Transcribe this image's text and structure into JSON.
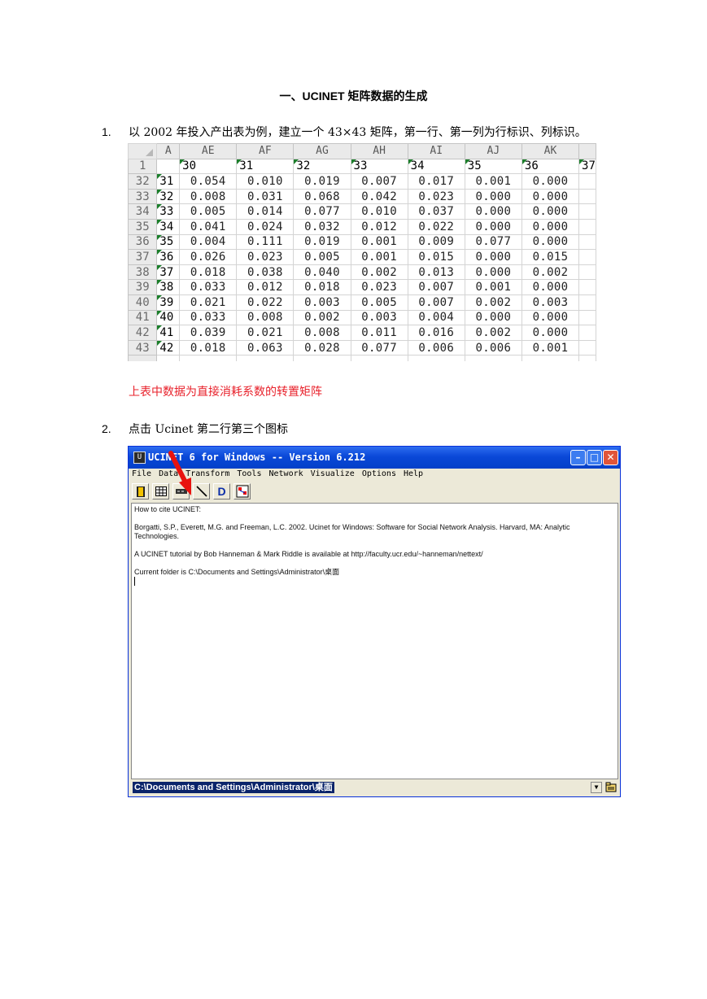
{
  "heading": "一、UCINET 矩阵数据的生成",
  "step1": {
    "num": "1.",
    "text": "以 2002 年投入产出表为例，建立一个 43×43 矩阵，第一行、第一列为行标识、列标识。"
  },
  "sheet": {
    "col_a": "A",
    "columns": [
      "AE",
      "AF",
      "AG",
      "AH",
      "AI",
      "AJ",
      "AK"
    ],
    "header_row": {
      "row_num": "1",
      "labels": [
        "30",
        "31",
        "32",
        "33",
        "34",
        "35",
        "36",
        "37"
      ]
    },
    "rows": [
      {
        "r": "32",
        "label": "31",
        "values": [
          "0.054",
          "0.010",
          "0.019",
          "0.007",
          "0.017",
          "0.001",
          "0.000"
        ]
      },
      {
        "r": "33",
        "label": "32",
        "values": [
          "0.008",
          "0.031",
          "0.068",
          "0.042",
          "0.023",
          "0.000",
          "0.000"
        ]
      },
      {
        "r": "34",
        "label": "33",
        "values": [
          "0.005",
          "0.014",
          "0.077",
          "0.010",
          "0.037",
          "0.000",
          "0.000"
        ]
      },
      {
        "r": "35",
        "label": "34",
        "values": [
          "0.041",
          "0.024",
          "0.032",
          "0.012",
          "0.022",
          "0.000",
          "0.000"
        ]
      },
      {
        "r": "36",
        "label": "35",
        "values": [
          "0.004",
          "0.111",
          "0.019",
          "0.001",
          "0.009",
          "0.077",
          "0.000"
        ]
      },
      {
        "r": "37",
        "label": "36",
        "values": [
          "0.026",
          "0.023",
          "0.005",
          "0.001",
          "0.015",
          "0.000",
          "0.015"
        ]
      },
      {
        "r": "38",
        "label": "37",
        "values": [
          "0.018",
          "0.038",
          "0.040",
          "0.002",
          "0.013",
          "0.000",
          "0.002"
        ]
      },
      {
        "r": "39",
        "label": "38",
        "values": [
          "0.033",
          "0.012",
          "0.018",
          "0.023",
          "0.007",
          "0.001",
          "0.000"
        ]
      },
      {
        "r": "40",
        "label": "39",
        "values": [
          "0.021",
          "0.022",
          "0.003",
          "0.005",
          "0.007",
          "0.002",
          "0.003"
        ]
      },
      {
        "r": "41",
        "label": "40",
        "values": [
          "0.033",
          "0.008",
          "0.002",
          "0.003",
          "0.004",
          "0.000",
          "0.000"
        ]
      },
      {
        "r": "42",
        "label": "41",
        "values": [
          "0.039",
          "0.021",
          "0.008",
          "0.011",
          "0.016",
          "0.002",
          "0.000"
        ]
      },
      {
        "r": "43",
        "label": "42",
        "values": [
          "0.018",
          "0.063",
          "0.028",
          "0.077",
          "0.006",
          "0.006",
          "0.001"
        ]
      }
    ]
  },
  "note": "上表中数据为直接消耗系数的转置矩阵",
  "step2": {
    "num": "2.",
    "text": "点击 Ucinet 第二行第三个图标"
  },
  "ucinet": {
    "title": "UCINET 6 for Windows -- Version 6.212",
    "menu": [
      "File",
      "Data",
      "Transform",
      "Tools",
      "Network",
      "Visualize",
      "Options",
      "Help"
    ],
    "toolbar_icons": [
      "exit-icon",
      "spreadsheet-icon",
      "matrix-editor-icon",
      "line-icon",
      "d-icon",
      "netdraw-icon"
    ],
    "content": [
      "How to cite UCINET:",
      "Borgatti, S.P., Everett, M.G. and Freeman, L.C. 2002. Ucinet for Windows: Software for Social Network Analysis. Harvard, MA: Analytic Technologies.",
      "A UCINET tutorial by Bob Hanneman & Mark Riddle is available at http://faculty.ucr.edu/~hanneman/nettext/",
      "Current folder is C:\\Documents and Settings\\Administrator\\桌面"
    ],
    "folder_path": "C:\\Documents and Settings\\Administrator\\桌面",
    "accent": "#0a48d8",
    "arrow_color": "#e8130f"
  }
}
